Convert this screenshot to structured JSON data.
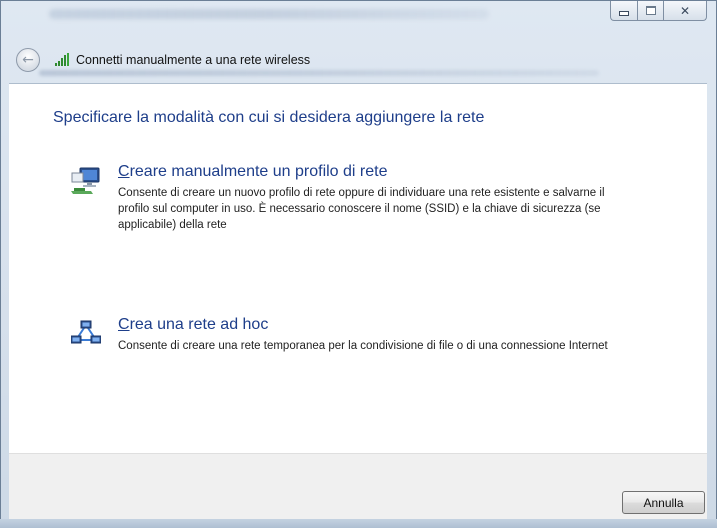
{
  "window": {
    "controls": {
      "minimize_icon": "minimize-icon",
      "maximize_icon": "maximize-icon",
      "close_glyph": "✕"
    }
  },
  "header": {
    "back_icon": "←",
    "title": "Connetti manualmente a una rete wireless"
  },
  "main": {
    "heading": "Specificare la modalità con cui si desidera aggiungere la rete",
    "options": [
      {
        "title_accel": "C",
        "title_rest": "reare manualmente un profilo di rete",
        "description": "Consente di creare un nuovo profilo di rete oppure di individuare una rete esistente e salvarne il profilo sul computer in uso. È necessario conoscere il nome (SSID) e la chiave di sicurezza (se applicabile) della rete",
        "icon": "network-profile-icon"
      },
      {
        "title_accel": "C",
        "title_rest": "rea una rete ad hoc",
        "description": "Consente di creare una rete temporanea per la condivisione di file o di una connessione Internet",
        "icon": "adhoc-network-icon"
      }
    ]
  },
  "footer": {
    "cancel_label": "Annulla"
  },
  "colors": {
    "link_blue": "#1e3e8a",
    "signal_green": "#2f8a2f"
  }
}
